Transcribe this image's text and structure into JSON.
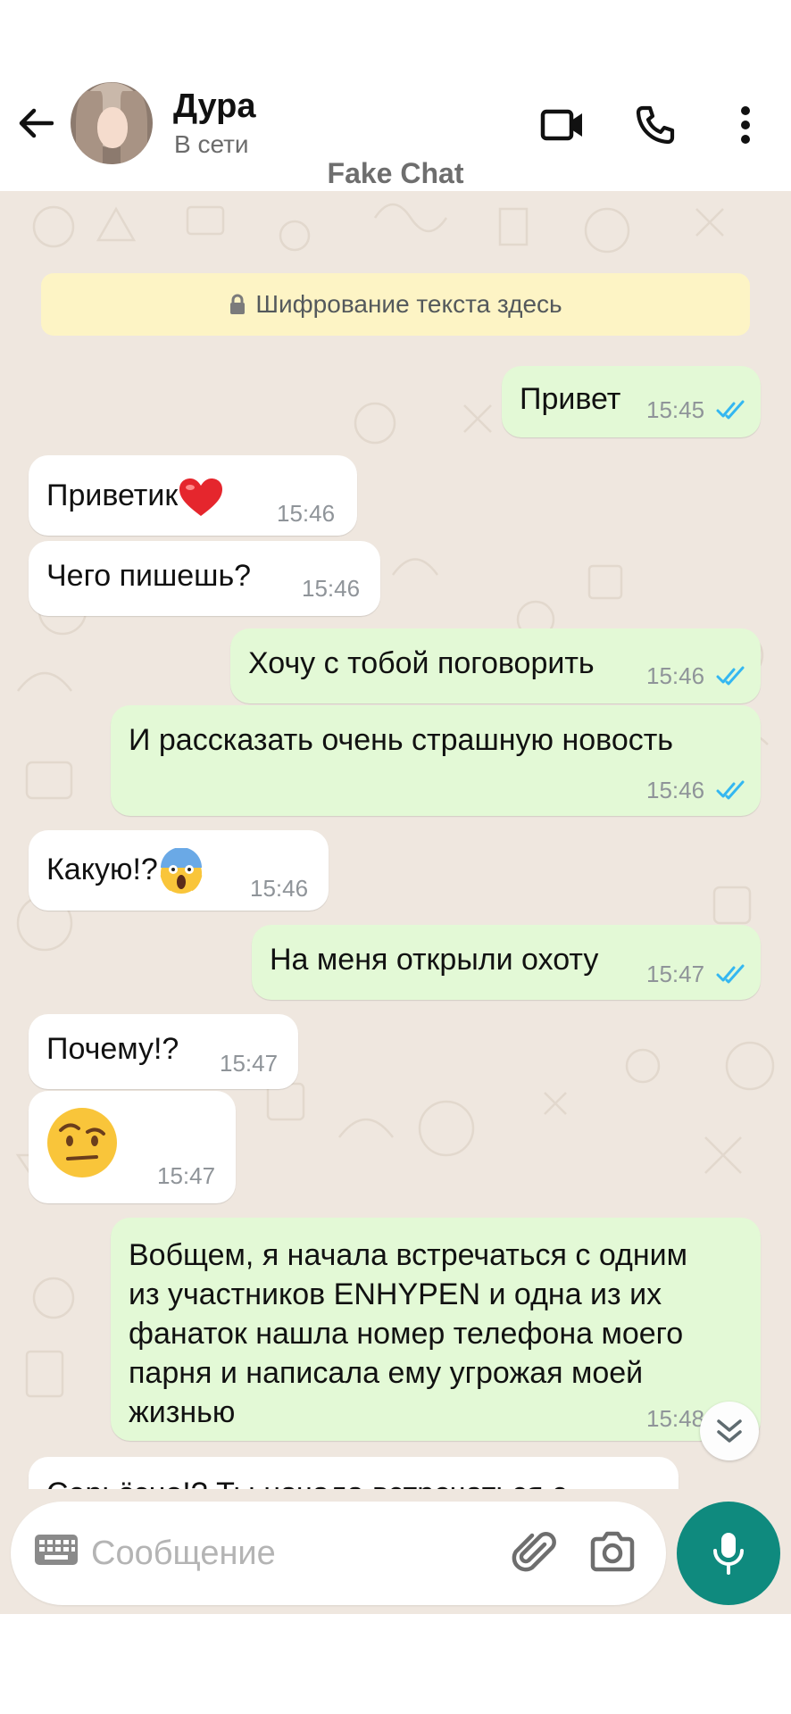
{
  "header": {
    "contact_name": "Дура",
    "contact_status": "В сети",
    "watermark": "Fake Chat",
    "icons": {
      "back": "back-arrow-icon",
      "video": "video-camera-icon",
      "call": "phone-icon",
      "menu": "more-vertical-icon"
    }
  },
  "chat": {
    "encryption_notice": "Шифрование текста здесь",
    "messages": [
      {
        "direction": "out",
        "text": "Привет",
        "time": "15:45",
        "status": "read"
      },
      {
        "direction": "in",
        "text": "Приветик",
        "emoji": "red-heart",
        "time": "15:46"
      },
      {
        "direction": "in",
        "text": "Чего пишешь?",
        "time": "15:46"
      },
      {
        "direction": "out",
        "text": "Хочу с тобой поговорить",
        "time": "15:46",
        "status": "read"
      },
      {
        "direction": "out",
        "text": "И рассказать очень страшную новость",
        "time": "15:46",
        "status": "read"
      },
      {
        "direction": "in",
        "text": "Какую!?",
        "emoji": "face-screaming-in-fear",
        "time": "15:46"
      },
      {
        "direction": "out",
        "text": "На меня открыли охоту",
        "time": "15:47",
        "status": "read"
      },
      {
        "direction": "in",
        "text": "Почему!?",
        "time": "15:47"
      },
      {
        "direction": "in",
        "text": "",
        "emoji": "face-with-raised-eyebrow",
        "time": "15:47"
      },
      {
        "direction": "out",
        "lines": [
          "Вобщем, я начала встречаться с одним",
          "из участников ENHYPEN и одна из их",
          "фанаток нашла номер телефона моего",
          "парня и написала ему угрожая моей",
          "жизнью"
        ],
        "time": "15:48",
        "status": "read"
      },
      {
        "direction": "in",
        "text": "Серьёзно!? Ты начала встречаться с",
        "partial": true
      }
    ]
  },
  "composer": {
    "placeholder": "Сообщение",
    "icons": {
      "keyboard": "keyboard-icon",
      "attach": "paperclip-icon",
      "camera": "camera-icon",
      "mic": "microphone-icon",
      "scroll": "double-chevron-down-icon"
    }
  },
  "colors": {
    "chat_background": "#efe7df",
    "incoming_bubble": "#ffffff",
    "outgoing_bubble": "#e3f9d6",
    "read_ticks": "#34b7f1",
    "accent": "#0f8a7e",
    "encryption_banner": "#fdf4c5"
  }
}
